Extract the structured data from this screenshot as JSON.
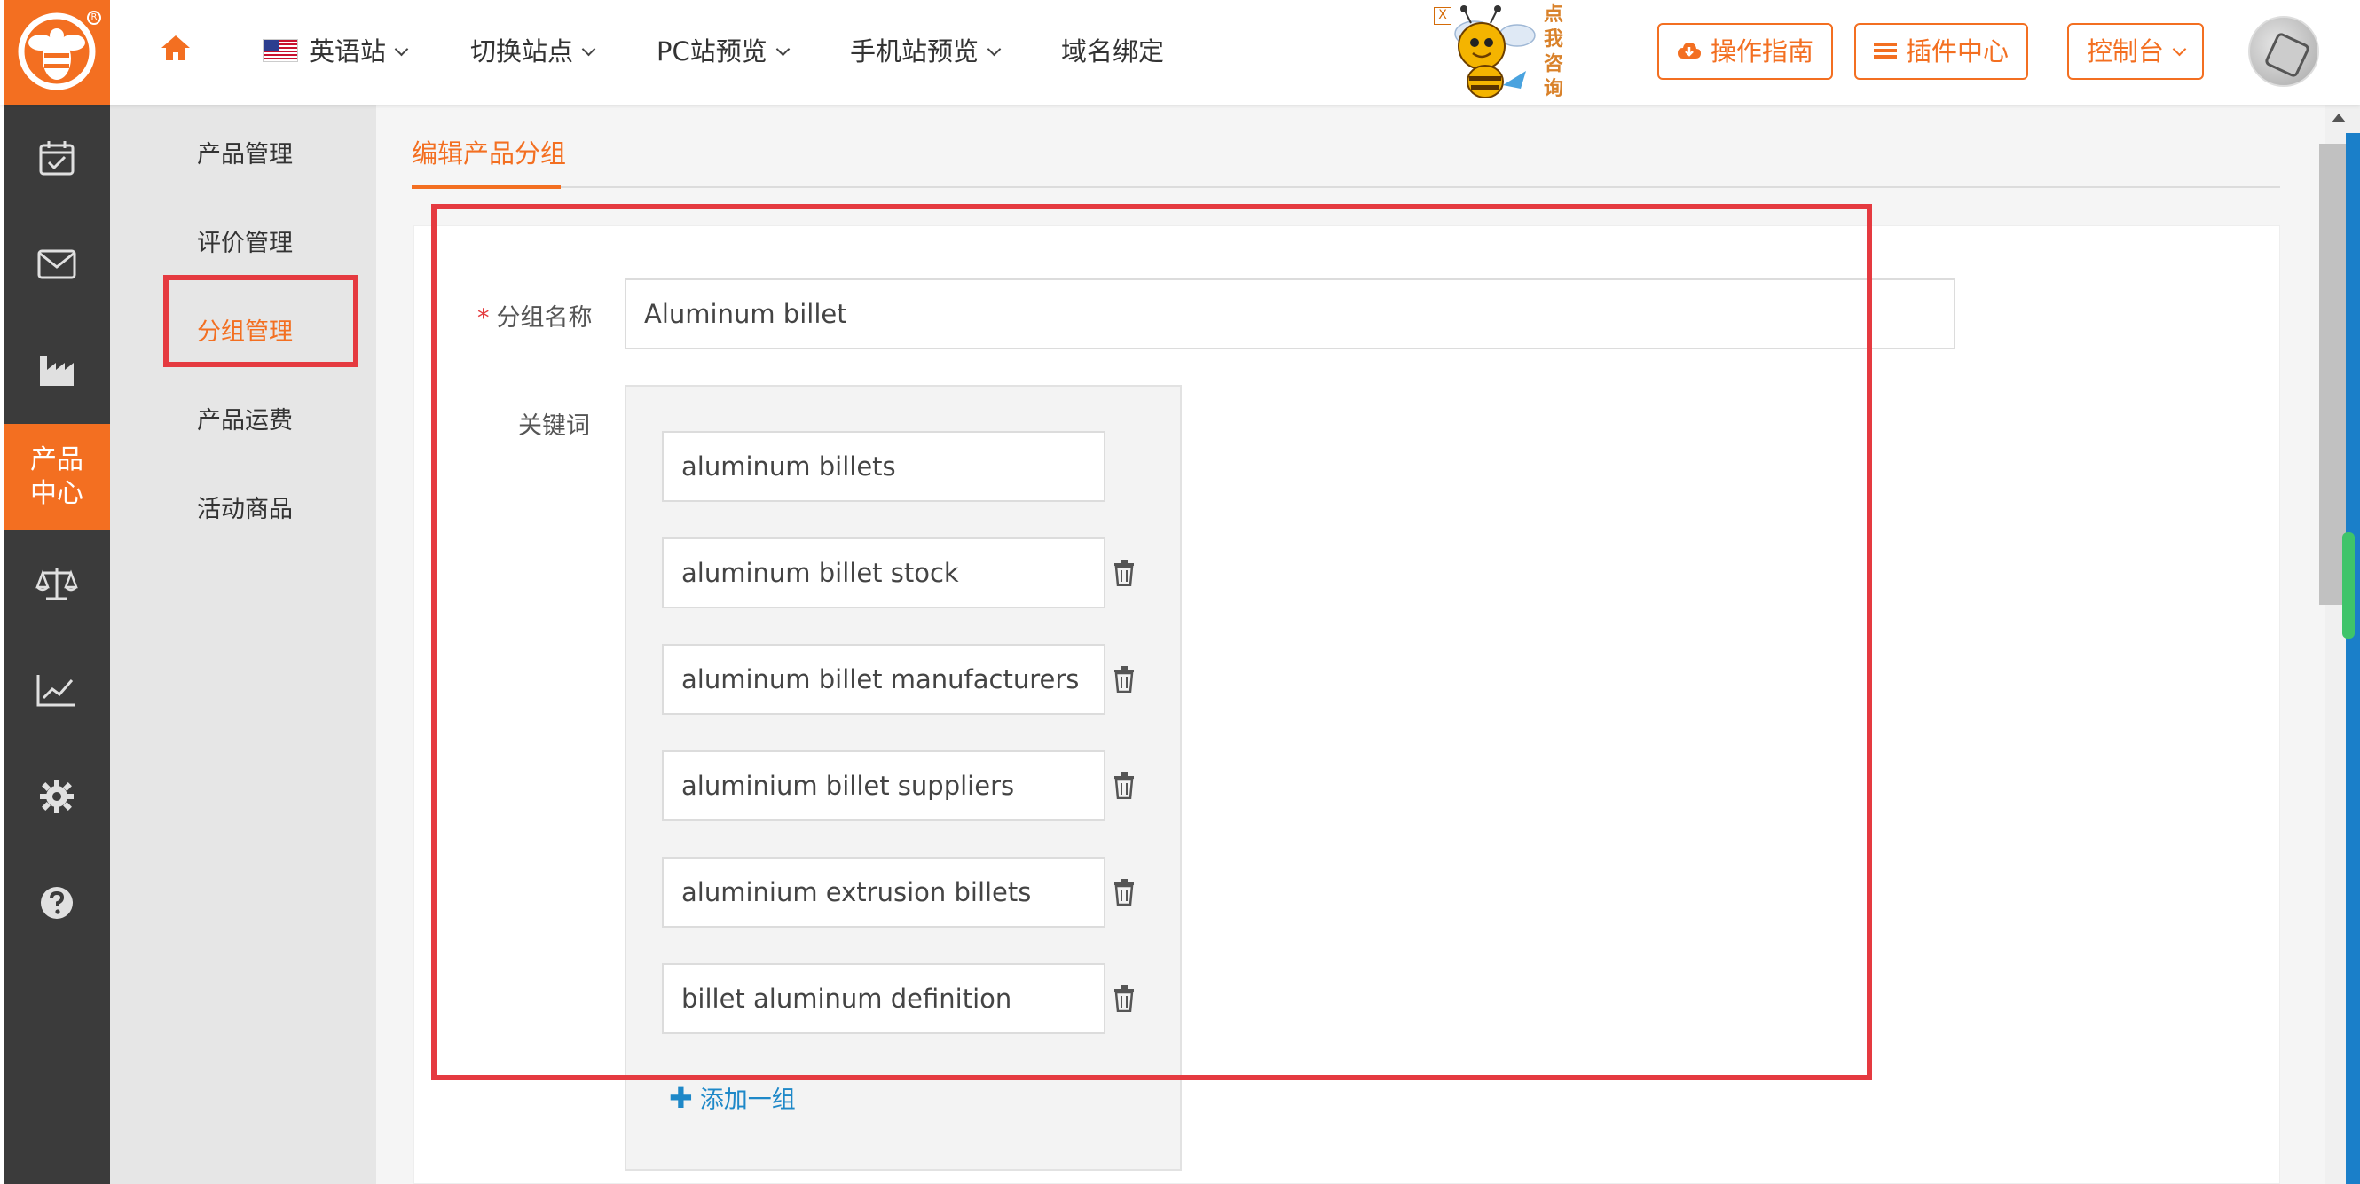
{
  "header": {
    "nav": {
      "language_label": "英语站",
      "switch_site_label": "切换站点",
      "pc_preview_label": "PC站预览",
      "mobile_preview_label": "手机站预览",
      "domain_bind_label": "域名绑定"
    },
    "mascot_text": "点我咨询",
    "mascot_close": "X",
    "buttons": {
      "guide_label": "操作指南",
      "plugins_label": "插件中心",
      "console_label": "控制台"
    },
    "accent_color": "#f36f21"
  },
  "sidebar": {
    "icons": [
      "calendar-check-icon",
      "mail-icon",
      "factory-icon",
      "product-center",
      "scale-icon",
      "trend-chart-icon",
      "gear-icon",
      "help-icon"
    ],
    "active_label_line1": "产品",
    "active_label_line2": "中心"
  },
  "submenu": {
    "items": [
      {
        "label": "产品管理",
        "active": false
      },
      {
        "label": "评价管理",
        "active": false
      },
      {
        "label": "分组管理",
        "active": true
      },
      {
        "label": "产品运费",
        "active": false
      },
      {
        "label": "活动商品",
        "active": false
      }
    ]
  },
  "main": {
    "tab_title": "编辑产品分组",
    "form": {
      "group_name_label": "分组名称",
      "group_name_required_mark": "*",
      "group_name_value": "Aluminum billet",
      "keywords_label": "关键词",
      "keywords": [
        "aluminum billets",
        "aluminum billet stock",
        "aluminum billet manufacturers",
        "aluminium billet suppliers",
        "aluminium extrusion billets",
        "billet aluminum definition"
      ],
      "add_group_label": "添加一组"
    }
  }
}
